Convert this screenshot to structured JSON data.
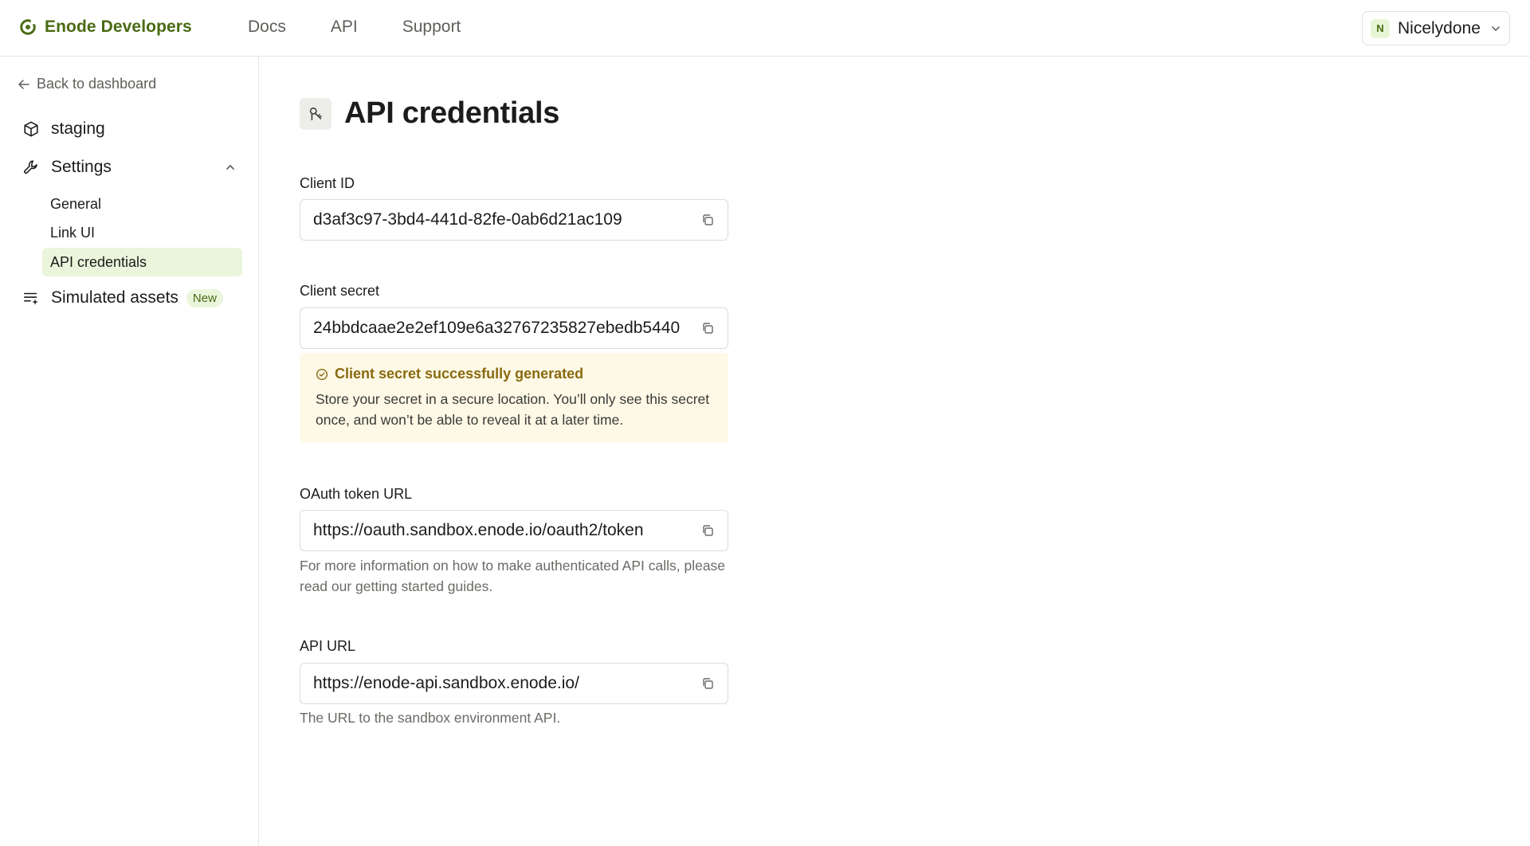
{
  "header": {
    "brand": "Enode Developers",
    "nav": [
      "Docs",
      "API",
      "Support"
    ],
    "org": {
      "initial": "N",
      "name": "Nicelydone"
    }
  },
  "sidebar": {
    "back_label": "Back to dashboard",
    "environment": "staging",
    "settings_label": "Settings",
    "settings_items": [
      "General",
      "Link UI",
      "API credentials"
    ],
    "active_item": "API credentials",
    "simulated_label": "Simulated assets",
    "simulated_badge": "New"
  },
  "main": {
    "title": "API credentials",
    "client_id": {
      "label": "Client ID",
      "value": "d3af3c97-3bd4-441d-82fe-0ab6d21ac109"
    },
    "client_secret": {
      "label": "Client secret",
      "value": "24bbdcaae2e2ef109e6a32767235827ebedb5440"
    },
    "alert": {
      "title": "Client secret successfully generated",
      "body": "Store your secret in a secure location. You’ll only see this secret once, and won’t be able to reveal it at a later time."
    },
    "oauth": {
      "label": "OAuth token URL",
      "value": "https://oauth.sandbox.enode.io/oauth2/token",
      "help": "For more information on how to make authenticated API calls, please read our getting started guides."
    },
    "api_url": {
      "label": "API URL",
      "value": "https://enode-api.sandbox.enode.io/",
      "help": "The URL to the sandbox environment API."
    }
  },
  "colors": {
    "brand": "#4a6a14",
    "active_bg": "#eaf5dc",
    "alert_bg": "#fdf9e6",
    "alert_title": "#8a6a10"
  }
}
